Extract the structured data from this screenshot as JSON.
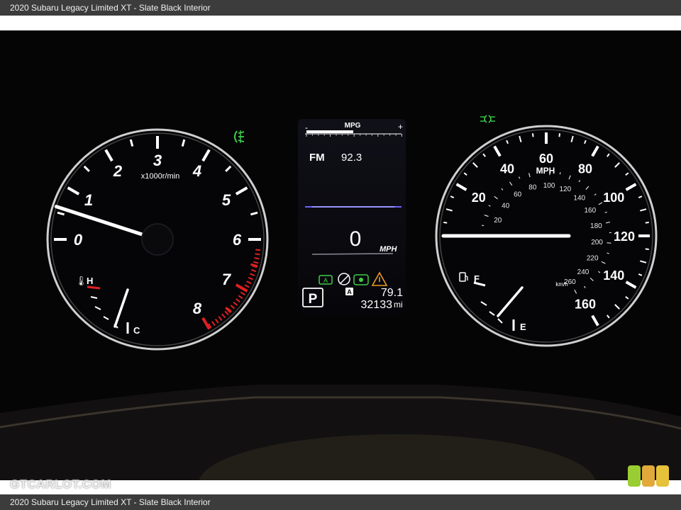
{
  "caption": {
    "top": "2020 Subaru Legacy Limited XT  -  Slate Black Interior",
    "bottom": "2020 Subaru Legacy Limited XT  -  Slate Black Interior"
  },
  "tachometer": {
    "scale_labels": [
      "0",
      "1",
      "2",
      "3",
      "4",
      "5",
      "6",
      "7",
      "8"
    ],
    "unit_label": "x1000r/min",
    "needle_rpm": 0.6,
    "redline_start_rpm": 6.2,
    "temp_high_label": "H",
    "temp_low_label": "C"
  },
  "speedometer": {
    "mph_labels": [
      "20",
      "40",
      "60",
      "80",
      "100",
      "120",
      "140",
      "160"
    ],
    "unit_label": "MPH",
    "kmh_labels": [
      "20",
      "40",
      "60",
      "80",
      "100",
      "120",
      "140",
      "160",
      "180",
      "200",
      "220",
      "240",
      "260"
    ],
    "kmh_unit": "km/h",
    "needle_mph": 0,
    "fuel_full_label": "F",
    "fuel_empty_label": "E"
  },
  "center_display": {
    "mpg_label": "MPG",
    "mpg_minus": "-",
    "mpg_plus": "+",
    "radio_band": "FM",
    "radio_freq": "92.3",
    "speed_value": "0",
    "speed_unit": "MPH",
    "gear": "P",
    "auto_badge": "A",
    "temperature": "79.1",
    "odometer_value": "32133",
    "odometer_unit": "mi"
  },
  "colors": {
    "needle": "#ffffff",
    "redline": "#e02020",
    "indicator_green": "#3ecf4a",
    "indicator_orange": "#e89a20",
    "bezel": "#d8d8d8"
  },
  "icons": [
    "fog-light-icon",
    "headlight-icon",
    "coolant-temp-icon",
    "fuel-pump-icon",
    "eyesight-icon",
    "lane-keep-icon",
    "traction-off-icon"
  ],
  "watermark": "GTCARLOT.COM"
}
